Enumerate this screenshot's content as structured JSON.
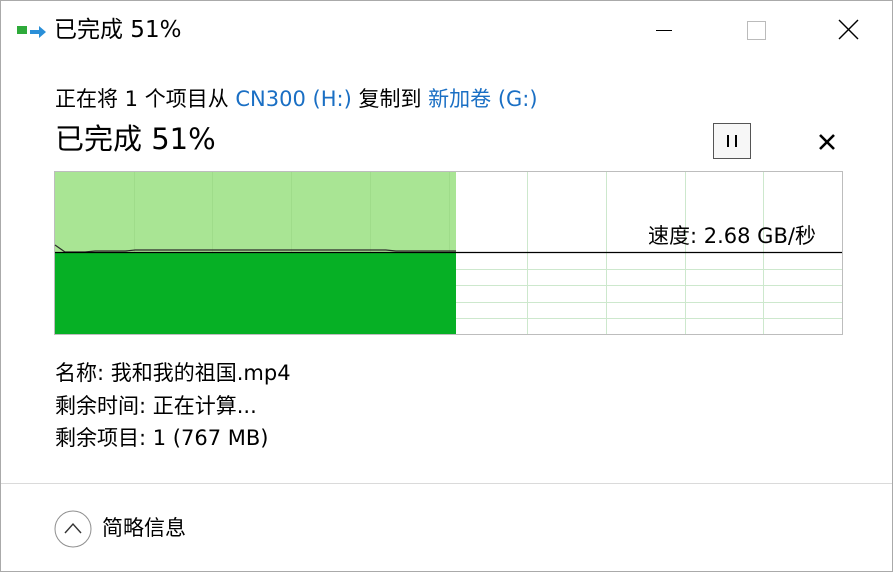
{
  "window": {
    "title": "已完成 51%"
  },
  "copy": {
    "prefix": "正在将 1 个项目从 ",
    "source": "CN300 (H:)",
    "middle": " 复制到 ",
    "destination": "新加卷 (G:)",
    "heading": "已完成 51%",
    "progress_percent": 51
  },
  "speed": {
    "label": "速度: 2.68 GB/秒",
    "current_level": 0.5
  },
  "details": {
    "name": "名称: 我和我的祖国.mp4",
    "time_remaining": "剩余时间: 正在计算...",
    "items_remaining": "剩余项目: 1 (767 MB)"
  },
  "footer": {
    "less_details": "简略信息"
  },
  "icons": {
    "app": "copy-progress-icon",
    "minimize": "minimize-icon",
    "maximize": "maximize-icon",
    "close": "close-icon",
    "pause": "pause-icon",
    "cancel": "cancel-icon",
    "collapse": "chevron-up-icon"
  },
  "colors": {
    "progress_fill": "#a9e594",
    "speed_fill": "#06b025",
    "grid_line": "#cde8cd",
    "link": "#1a6fc4",
    "speed_line": "#000000"
  }
}
